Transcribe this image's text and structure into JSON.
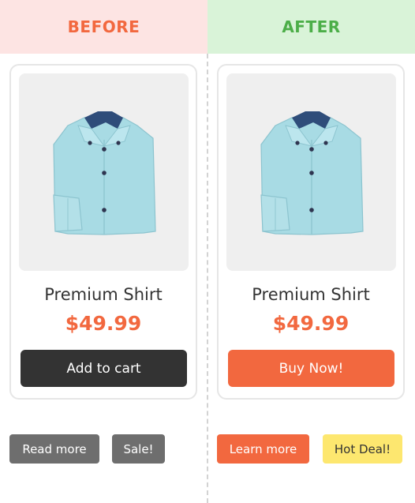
{
  "before": {
    "heading": "BEFORE",
    "product": {
      "title": "Premium Shirt",
      "price": "$49.99",
      "image_icon": "shirt-icon"
    },
    "cta_label": "Add to cart",
    "tags": [
      "Read more",
      "Sale!"
    ]
  },
  "after": {
    "heading": "AFTER",
    "product": {
      "title": "Premium Shirt",
      "price": "$49.99",
      "image_icon": "shirt-icon"
    },
    "cta_label": "Buy Now!",
    "tags": [
      "Learn more",
      "Hot Deal!"
    ]
  },
  "colors": {
    "accent_orange": "#f2683f",
    "before_header_bg": "#fde4e3",
    "after_header_bg": "#d9f3d8",
    "after_header_text": "#4cae48",
    "dark_button": "#333333",
    "grey_tag": "#6e6e6e",
    "yellow_tag": "#fde76f"
  }
}
